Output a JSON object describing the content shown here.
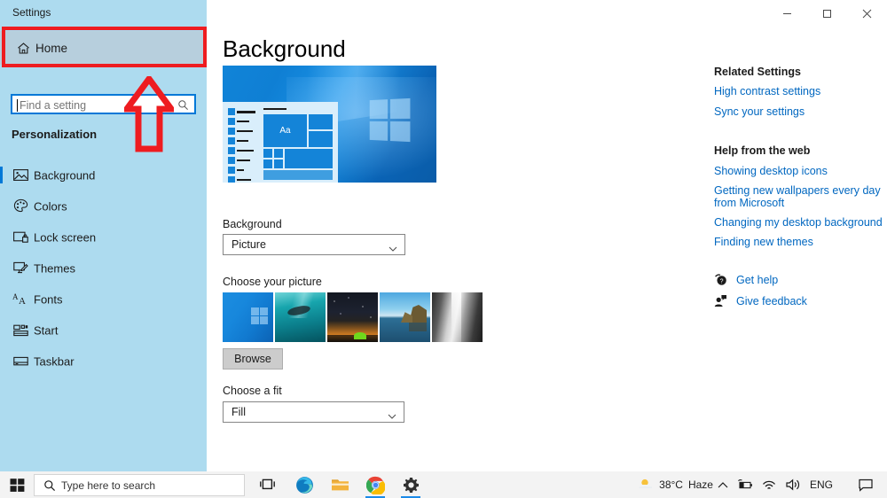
{
  "window": {
    "title": "Settings",
    "controls": {
      "minimize": "minimize",
      "maximize": "restore",
      "close": "close"
    }
  },
  "sidebar": {
    "home_label": "Home",
    "search": {
      "placeholder": "Find a setting",
      "value": ""
    },
    "section_title": "Personalization",
    "items": [
      {
        "label": "Background",
        "icon": "image-icon",
        "selected": true
      },
      {
        "label": "Colors",
        "icon": "palette-icon",
        "selected": false
      },
      {
        "label": "Lock screen",
        "icon": "lock-screen-icon",
        "selected": false
      },
      {
        "label": "Themes",
        "icon": "themes-icon",
        "selected": false
      },
      {
        "label": "Fonts",
        "icon": "fonts-icon",
        "selected": false
      },
      {
        "label": "Start",
        "icon": "start-icon",
        "selected": false
      },
      {
        "label": "Taskbar",
        "icon": "taskbar-icon",
        "selected": false
      }
    ]
  },
  "main": {
    "page_title": "Background",
    "preview_tile_text": "Aa",
    "background_label": "Background",
    "background_value": "Picture",
    "choose_picture_label": "Choose your picture",
    "thumbnails": [
      {
        "name": "windows-hero-wallpaper",
        "selected": true
      },
      {
        "name": "underwater-wallpaper",
        "selected": false
      },
      {
        "name": "night-sky-wallpaper",
        "selected": false
      },
      {
        "name": "coastal-rocks-wallpaper",
        "selected": false
      },
      {
        "name": "grayscale-cliff-wallpaper",
        "selected": false
      }
    ],
    "browse_label": "Browse",
    "fit_label": "Choose a fit",
    "fit_value": "Fill"
  },
  "right_panel": {
    "related_settings_title": "Related Settings",
    "related_links": [
      "High contrast settings",
      "Sync your settings"
    ],
    "help_title": "Help from the web",
    "help_links": [
      "Showing desktop icons",
      "Getting new wallpapers every day from Microsoft",
      "Changing my desktop background",
      "Finding new themes"
    ],
    "get_help_label": "Get help",
    "give_feedback_label": "Give feedback"
  },
  "taskbar": {
    "search_placeholder": "Type here to search",
    "apps": [
      {
        "name": "task-view-icon"
      },
      {
        "name": "microsoft-edge-icon"
      },
      {
        "name": "file-explorer-icon"
      },
      {
        "name": "google-chrome-icon"
      },
      {
        "name": "settings-icon"
      }
    ],
    "tray": {
      "temperature": "38°C",
      "weather": "Haze",
      "language": "ENG"
    }
  },
  "annotations": {
    "highlight_color": "#ee1c20",
    "highlight_target": "Home",
    "arrow_target": "Home"
  },
  "colors": {
    "sidebar_bg": "#addbef",
    "accent": "#0078d7",
    "link": "#0067c0",
    "home_highlight": "#b7cfdd"
  }
}
